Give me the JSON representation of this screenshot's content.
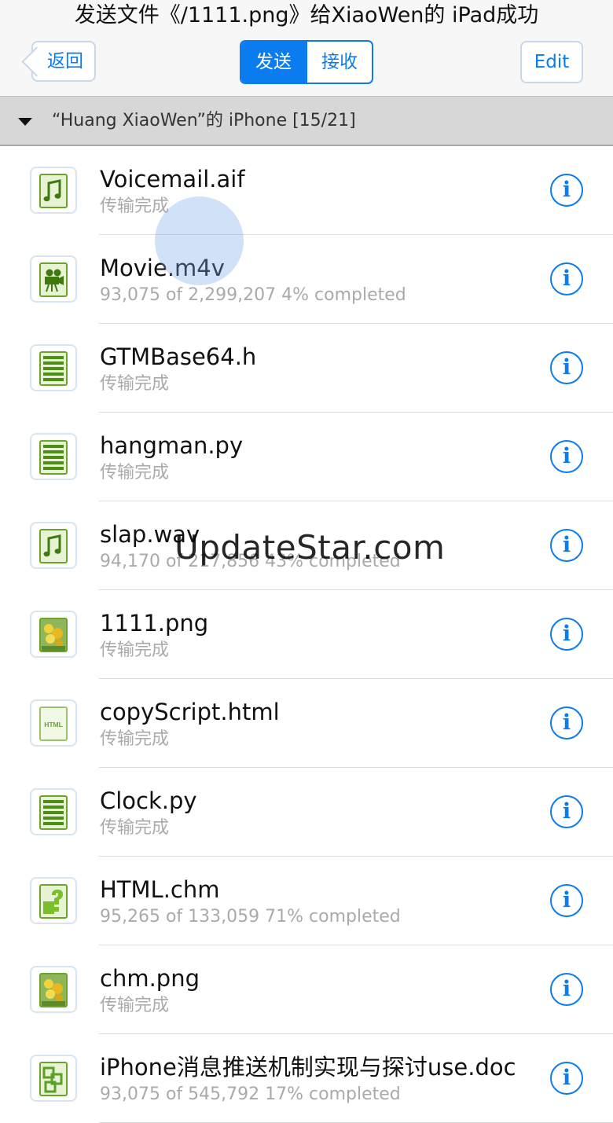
{
  "header": {
    "title": "发送文件《/1111.png》给XiaoWen的 iPad成功",
    "back_label": "返回",
    "segments": [
      "发送",
      "接收"
    ],
    "edit_label": "Edit"
  },
  "section": {
    "title": "“Huang XiaoWen”的 iPhone [15/21]"
  },
  "files": [
    {
      "name": "Voicemail.aif",
      "status": "传输完成",
      "icon": "audio-file-icon"
    },
    {
      "name": "Movie.m4v",
      "status": "93,075 of 2,299,207 4% completed",
      "icon": "video-file-icon"
    },
    {
      "name": "GTMBase64.h",
      "status": "传输完成",
      "icon": "text-file-icon"
    },
    {
      "name": "hangman.py",
      "status": "传输完成",
      "icon": "text-file-icon"
    },
    {
      "name": "slap.wav",
      "status": "94,170 of 217,856 43% completed",
      "icon": "audio-file-icon"
    },
    {
      "name": "1111.png",
      "status": "传输完成",
      "icon": "image-file-icon"
    },
    {
      "name": "copyScript.html",
      "status": "传输完成",
      "icon": "html-file-icon"
    },
    {
      "name": "Clock.py",
      "status": "传输完成",
      "icon": "text-file-icon"
    },
    {
      "name": "HTML.chm",
      "status": "95,265 of 133,059 71% completed",
      "icon": "help-file-icon"
    },
    {
      "name": "chm.png",
      "status": "传输完成",
      "icon": "image-file-icon"
    },
    {
      "name": "iPhone消息推送机制实现与探讨use.doc",
      "status": "93,075 of 545,792 17% completed",
      "icon": "doc-file-icon"
    }
  ],
  "info_glyph": "i",
  "html_icon_label": "HTML",
  "watermark": "UpdateStar.com",
  "colors": {
    "accent": "#0a7cf0",
    "icon_green": "#5a9a1e",
    "section_bg": "#d7d7d7",
    "status_gray": "#aaaaaa"
  }
}
